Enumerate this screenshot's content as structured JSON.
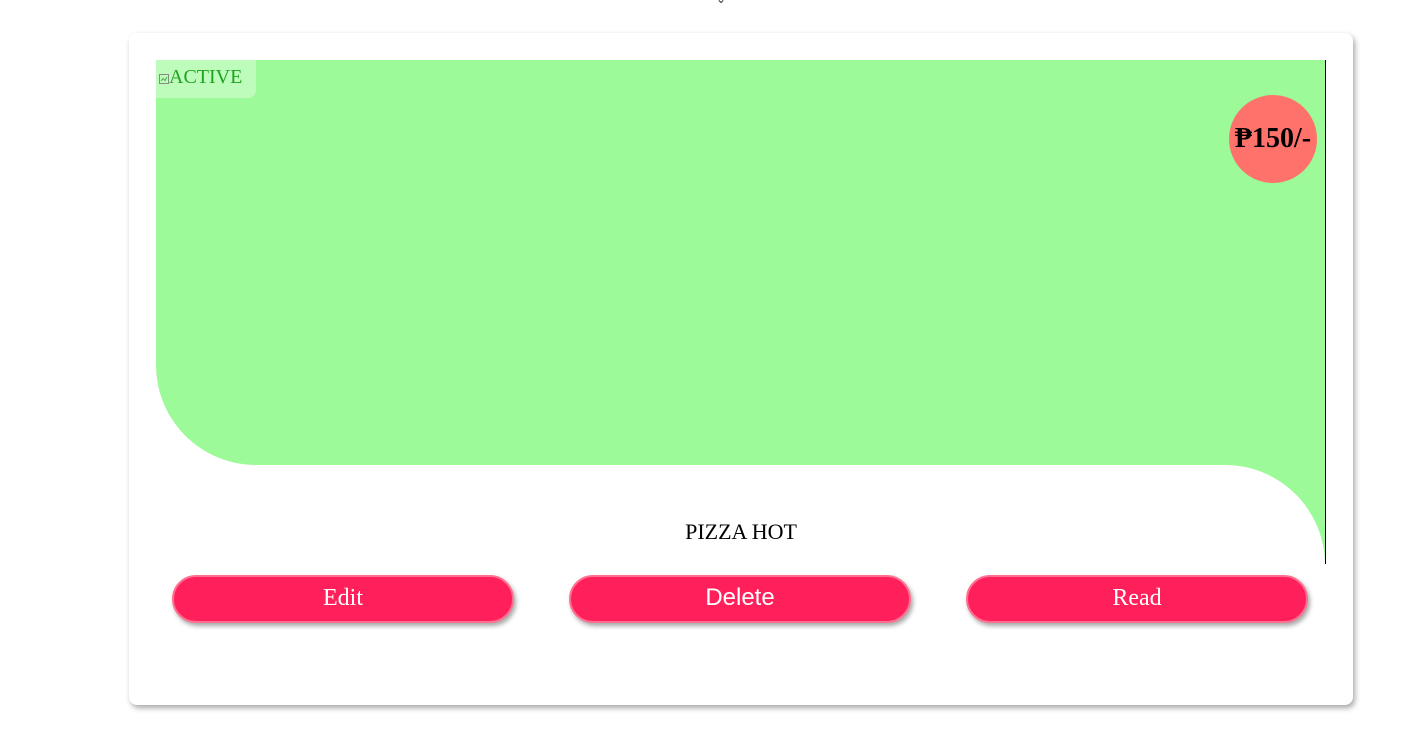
{
  "card": {
    "status_badge": "ACTIVE",
    "price": "₱150/-",
    "title": "PIZZA HOT"
  },
  "actions": {
    "edit_label": "Edit",
    "delete_label": "Delete",
    "read_label": "Read"
  },
  "colors": {
    "image_background": "#9cfa98",
    "price_badge": "#ff726b",
    "button": "#ff1f5a",
    "status_text": "#21a321"
  },
  "icons": {
    "status_image": "broken-image-icon"
  }
}
